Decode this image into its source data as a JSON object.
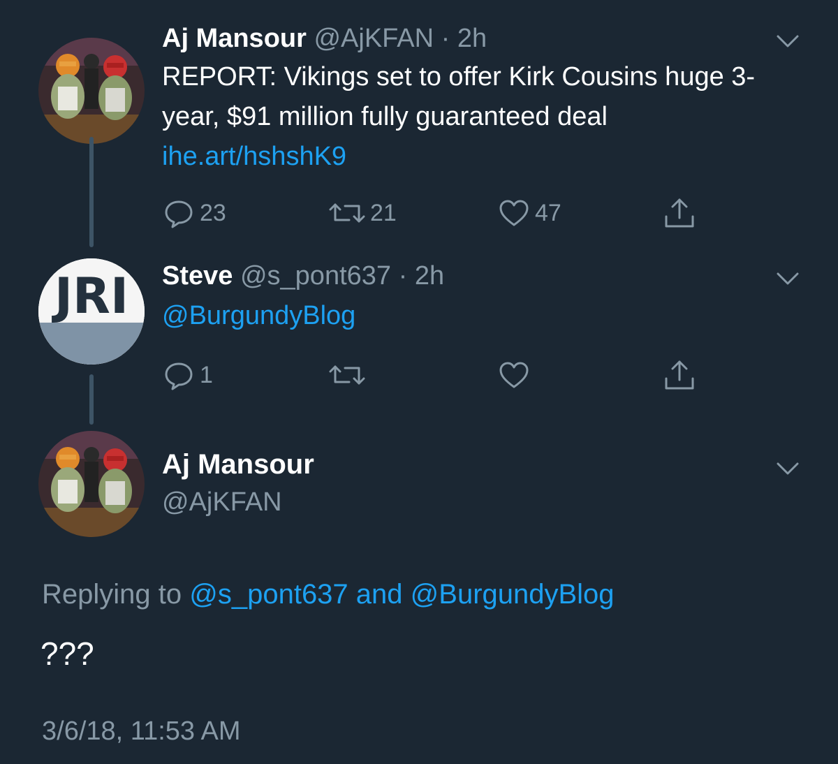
{
  "colors": {
    "background": "#1b2733",
    "text": "#ffffff",
    "muted": "#8899a6",
    "link": "#1da1f2",
    "thread_line": "#3d5466"
  },
  "tweets": [
    {
      "name": "Aj Mansour",
      "handle": "@AjKFAN",
      "dot": "·",
      "time": "2h",
      "text": "REPORT: Vikings set to offer Kirk Cousins huge 3-year, $91 million fully guaranteed deal ",
      "link": "ihe.art/hshshK9",
      "replies": "23",
      "retweets": "21",
      "likes": "47",
      "icons": [
        "reply-icon",
        "retweet-icon",
        "like-icon",
        "share-icon",
        "chevron-down-icon"
      ]
    },
    {
      "name": "Steve",
      "handle": "@s_pont637",
      "dot": "·",
      "time": "2h",
      "link": "@BurgundyBlog",
      "avatar_text": "JRI",
      "replies": "1",
      "icons": [
        "reply-icon",
        "retweet-icon",
        "like-icon",
        "share-icon",
        "chevron-down-icon"
      ]
    }
  ],
  "main_tweet": {
    "name": "Aj Mansour",
    "handle": "@AjKFAN",
    "replying_prefix": "Replying to ",
    "reply_user_1": "@s_pont637",
    "reply_and": " and ",
    "reply_user_2": "@BurgundyBlog",
    "text": "???",
    "timestamp": "3/6/18, 11:53 AM"
  }
}
